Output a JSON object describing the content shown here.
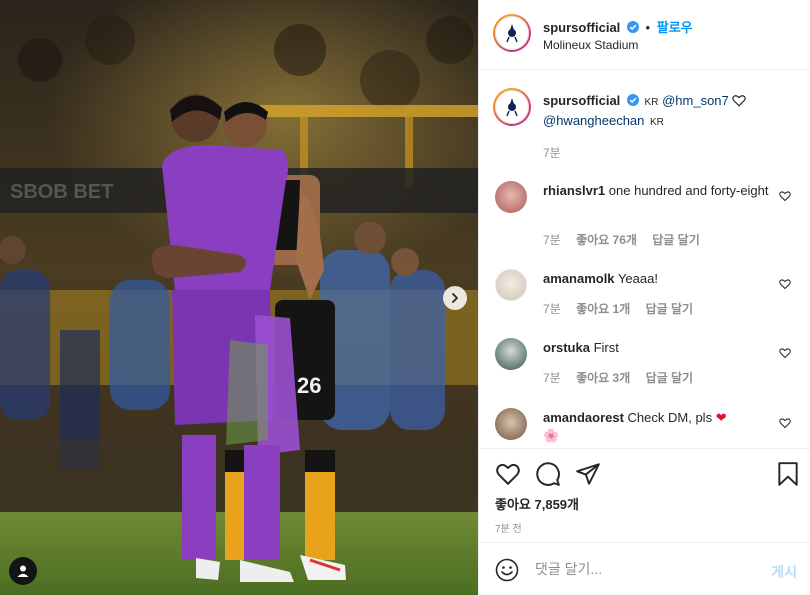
{
  "post": {
    "author": "spursofficial",
    "follow_label": "팔로우",
    "dot": "•",
    "location": "Molineux Stadium",
    "caption": {
      "author": "spursofficial",
      "kr_tag": "KR",
      "mention1": "@hm_son7",
      "mention2": "@hwangheechan",
      "kr_tag2": "KR",
      "time": "7분"
    },
    "likes_label": "좋아요 7,859개",
    "posted": "7분 전",
    "photo": {
      "jersey_number": "26"
    }
  },
  "comments": [
    {
      "user": "rhianslvr1",
      "text": "one hundred and forty-eight",
      "time": "7분",
      "likes": "좋아요 76개",
      "reply": "답글 달기"
    },
    {
      "user": "amanamolk",
      "text": "Yeaaa!",
      "time": "7분",
      "likes": "좋아요 1개",
      "reply": "답글 달기"
    },
    {
      "user": "orstuka",
      "text": "First",
      "time": "7분",
      "likes": "좋아요 3개",
      "reply": "답글 달기"
    },
    {
      "user": "amandaorest",
      "text": "Check DM, pls",
      "emoji_after": "❤",
      "emoji_line2": "🌸"
    }
  ],
  "add_comment": {
    "placeholder": "댓글 달기...",
    "post_label": "게시"
  },
  "colors": {
    "accent": "#0095f6",
    "verified": "#3897f0",
    "spurs_purple": "#8a3fc1",
    "wolves_gold": "#f0a020"
  },
  "icons": [
    "chevron-right-icon",
    "user-tag-icon",
    "verified-icon",
    "heart-icon",
    "comment-icon",
    "share-icon",
    "bookmark-icon",
    "emoji-icon"
  ]
}
